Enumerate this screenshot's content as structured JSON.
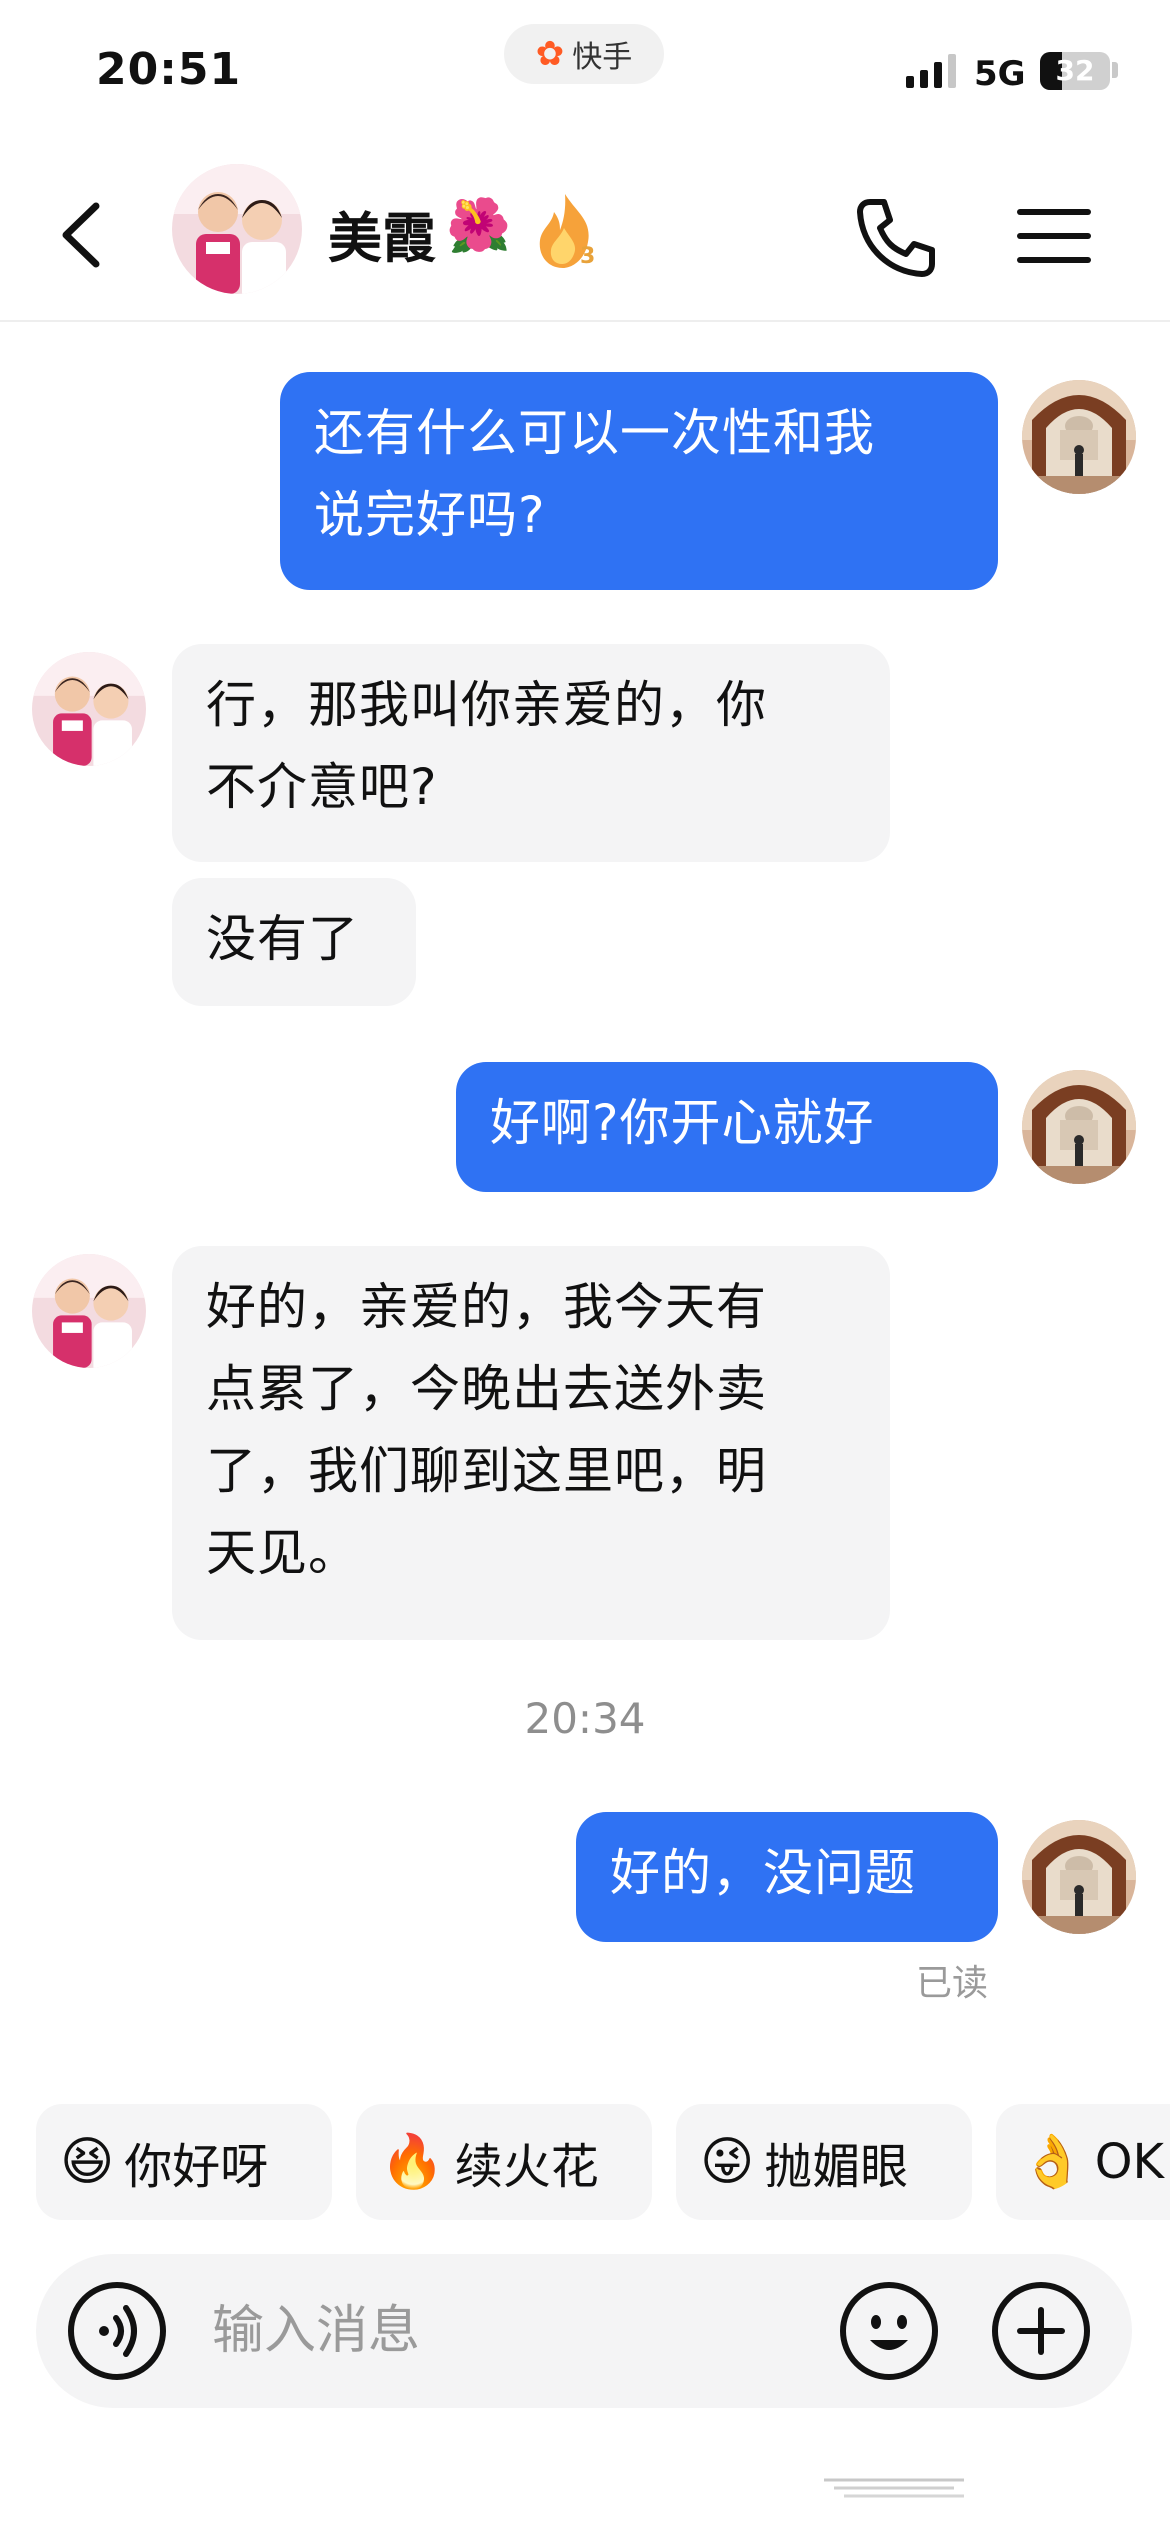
{
  "status_bar": {
    "time": "20:51",
    "app_label": "快手",
    "network": "5G",
    "battery": "32",
    "battery_level": 0.32
  },
  "header": {
    "contact_name": "美霞",
    "name_emoji": "🌺",
    "streak_count": "3"
  },
  "messages": [
    {
      "side": "out",
      "lines": [
        "还有什么可以一次性和我",
        "说完好吗?"
      ]
    },
    {
      "side": "in",
      "lines": [
        "行，那我叫你亲爱的，你",
        "不介意吧?"
      ]
    },
    {
      "side": "in",
      "lines": [
        "没有了"
      ]
    },
    {
      "side": "out",
      "lines": [
        "好啊?你开心就好"
      ]
    },
    {
      "side": "in",
      "lines": [
        "好的，亲爱的，我今天有",
        "点累了，今晚出去送外卖",
        "了，我们聊到这里吧，明",
        "天见。"
      ]
    },
    {
      "side": "out",
      "lines": [
        "好的，没问题"
      ]
    }
  ],
  "timestamp": "20:34",
  "read_status": "已读",
  "quick_replies": [
    {
      "icon": "laughing-emoji-icon",
      "emoji": "😆",
      "label": "你好呀"
    },
    {
      "icon": "fire-face-icon",
      "emoji": "🔥",
      "label": "续火花"
    },
    {
      "icon": "winking-bear-icon",
      "emoji": "😜",
      "label": "抛媚眼"
    },
    {
      "icon": "ok-hand-emoji-icon",
      "emoji": "👌",
      "label": "OK"
    }
  ],
  "input": {
    "placeholder": "输入消息"
  },
  "colors": {
    "outgoing_bubble": "#2f72f3",
    "incoming_bubble": "#f4f4f5",
    "brand_orange": "#ff5b24"
  }
}
